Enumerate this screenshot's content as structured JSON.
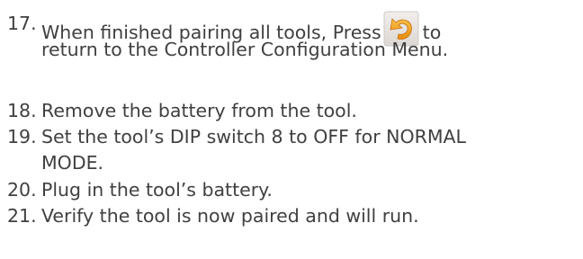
{
  "steps": [
    {
      "number": "17.",
      "line1_before_icon": "When finished pairing all tools,  Press",
      "line1_after_icon": "to",
      "icon": "return-arrow-icon",
      "line2": "return to the Controller Configuration Menu."
    },
    {
      "number": "18.",
      "text": "Remove the battery from the tool."
    },
    {
      "number": "19.",
      "line1": "Set the tool’s DIP switch 8 to OFF for NORMAL",
      "line2": "MODE."
    },
    {
      "number": "20.",
      "text": "Plug in the tool’s battery."
    },
    {
      "number": "21.",
      "text": "Verify the tool is now paired and will run."
    }
  ],
  "colors": {
    "text": "#404040",
    "icon_background": "#e6e2df",
    "icon_arrow": "#f3a21c"
  }
}
